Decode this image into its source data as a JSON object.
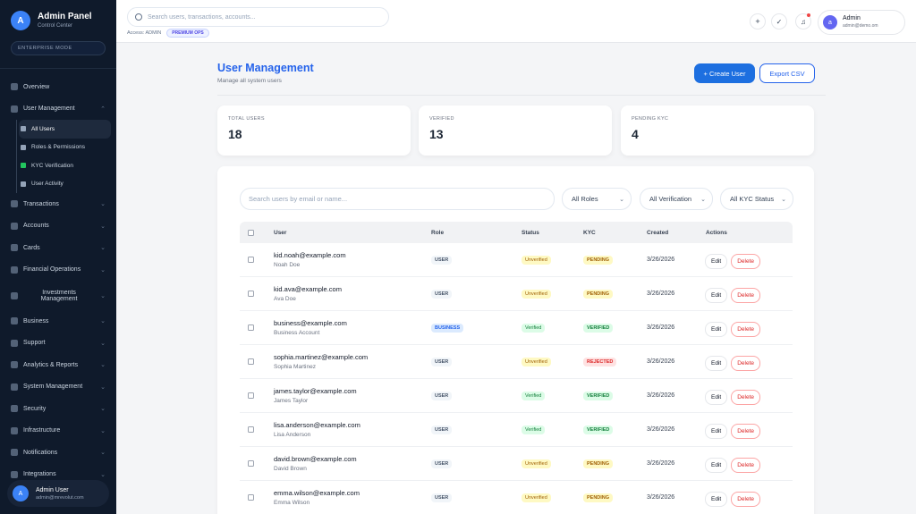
{
  "brand": {
    "logo_letter": "A",
    "title": "Admin Panel",
    "subtitle": "Control Center",
    "mode": "ENTERPRISE MODE"
  },
  "sidebar": {
    "items": [
      {
        "label": "Overview",
        "icon": "grid-icon"
      },
      {
        "label": "User Management",
        "icon": "users-icon",
        "expanded": true
      },
      {
        "label": "Transactions",
        "icon": "exchange-icon"
      },
      {
        "label": "Accounts",
        "icon": "bank-icon"
      },
      {
        "label": "Cards",
        "icon": "card-icon"
      },
      {
        "label": "Financial Operations",
        "icon": "finance-icon"
      },
      {
        "label": "Investments Management",
        "icon": "chart-icon"
      },
      {
        "label": "Business",
        "icon": "briefcase-icon"
      },
      {
        "label": "Support",
        "icon": "headset-icon"
      },
      {
        "label": "Analytics & Reports",
        "icon": "analytics-icon"
      },
      {
        "label": "System Management",
        "icon": "settings-icon"
      },
      {
        "label": "Security",
        "icon": "lock-icon"
      },
      {
        "label": "Infrastructure",
        "icon": "server-icon"
      },
      {
        "label": "Notifications",
        "icon": "bell-icon"
      },
      {
        "label": "Integrations",
        "icon": "plug-icon"
      }
    ],
    "sub_items": [
      {
        "label": "All Users",
        "active": true
      },
      {
        "label": "Roles & Permissions"
      },
      {
        "label": "KYC Verification"
      },
      {
        "label": "User Activity"
      }
    ],
    "user": {
      "avatar": "A",
      "name": "Admin User",
      "email": "admin@mrevolut.com"
    }
  },
  "topbar": {
    "search_placeholder": "Search users, transactions, accounts...",
    "access_label": "Access: ADMIN",
    "access_badge": "PREMIUM OPS",
    "user": {
      "avatar": "a",
      "name": "Admin",
      "email": "admin@demo.om"
    }
  },
  "page": {
    "title": "User Management",
    "subtitle": "Manage all system users",
    "create_label": "+ Create User",
    "export_label": "Export CSV"
  },
  "stats": [
    {
      "label": "TOTAL USERS",
      "value": "18"
    },
    {
      "label": "VERIFIED",
      "value": "13"
    },
    {
      "label": "PENDING KYC",
      "value": "4"
    }
  ],
  "filters": {
    "search_placeholder": "Search users by email or name...",
    "roles": "All Roles",
    "verification": "All Verification",
    "kyc": "All KYC Status"
  },
  "table": {
    "headers": {
      "user": "User",
      "role": "Role",
      "status": "Status",
      "kyc": "KYC",
      "created": "Created",
      "actions": "Actions"
    },
    "edit_label": "Edit",
    "delete_label": "Delete",
    "rows": [
      {
        "email": "kid.noah@example.com",
        "name": "Noah Doe",
        "role": "USER",
        "status": "Unverified",
        "kyc": "PENDING",
        "created": "3/26/2026"
      },
      {
        "email": "kid.ava@example.com",
        "name": "Ava Doe",
        "role": "USER",
        "status": "Unverified",
        "kyc": "PENDING",
        "created": "3/26/2026"
      },
      {
        "email": "business@example.com",
        "name": "Business Account",
        "role": "BUSINESS",
        "status": "Verified",
        "kyc": "VERIFIED",
        "created": "3/26/2026"
      },
      {
        "email": "sophia.martinez@example.com",
        "name": "Sophia Martinez",
        "role": "USER",
        "status": "Unverified",
        "kyc": "REJECTED",
        "created": "3/26/2026"
      },
      {
        "email": "james.taylor@example.com",
        "name": "James Taylor",
        "role": "USER",
        "status": "Verified",
        "kyc": "VERIFIED",
        "created": "3/26/2026"
      },
      {
        "email": "lisa.anderson@example.com",
        "name": "Lisa Anderson",
        "role": "USER",
        "status": "Verified",
        "kyc": "VERIFIED",
        "created": "3/26/2026"
      },
      {
        "email": "david.brown@example.com",
        "name": "David Brown",
        "role": "USER",
        "status": "Unverified",
        "kyc": "PENDING",
        "created": "3/26/2026"
      },
      {
        "email": "emma.wilson@example.com",
        "name": "Emma Wilson",
        "role": "USER",
        "status": "Unverified",
        "kyc": "PENDING",
        "created": "3/26/2026"
      }
    ]
  },
  "colors": {
    "accent": "#1d6fe0",
    "sidebar": "#0f1a2b",
    "danger": "#dc2626"
  }
}
